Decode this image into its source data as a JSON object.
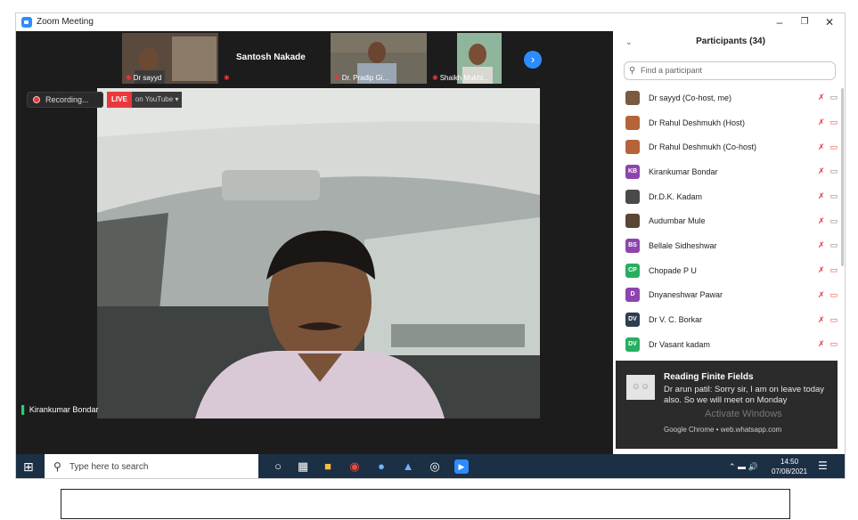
{
  "window": {
    "title": "Zoom Meeting"
  },
  "meeting": {
    "thumbnails": [
      {
        "name": "Dr sayyd"
      },
      {
        "name": "Santosh Nakade"
      },
      {
        "name": "Dr. Pradip Gi..."
      },
      {
        "name": "Shaikh Mukht..."
      }
    ],
    "recording_label": "Recording...",
    "live_label": "LIVE",
    "live_target": "on YouTube",
    "speaker_name": "Kirankumar Bondar"
  },
  "participants": {
    "header": "Participants (34)",
    "search_placeholder": "Find a participant",
    "list": [
      {
        "name": "Dr sayyd (Co-host, me)",
        "initials": "",
        "color": "#7a5a40"
      },
      {
        "name": "Dr Rahul Deshmukh (Host)",
        "initials": "",
        "color": "#b5643a"
      },
      {
        "name": "Dr Rahul Deshmukh (Co-host)",
        "initials": "",
        "color": "#b5643a"
      },
      {
        "name": "Kirankumar Bondar",
        "initials": "KB",
        "color": "#8e44ad"
      },
      {
        "name": "Dr.D.K. Kadam",
        "initials": "",
        "color": "#4a4a4a"
      },
      {
        "name": "Audumbar Mule",
        "initials": "",
        "color": "#5a4634"
      },
      {
        "name": "Bellale Sidheshwar",
        "initials": "BS",
        "color": "#8e44ad"
      },
      {
        "name": "Chopade P U",
        "initials": "CP",
        "color": "#27ae60"
      },
      {
        "name": "Dnyaneshwar Pawar",
        "initials": "D",
        "color": "#8e44ad"
      },
      {
        "name": "Dr V. C. Borkar",
        "initials": "DV",
        "color": "#2c3e50"
      },
      {
        "name": "Dr Vasant kadam",
        "initials": "DV",
        "color": "#27ae60"
      }
    ]
  },
  "notification": {
    "title": "Reading Finite Fields",
    "body": "Dr arun patil: Sorry sir, I am on leave today also. So we will meet on Monday",
    "source": "Google Chrome • web.whatsapp.com",
    "watermark": "Activate Windows"
  },
  "taskbar": {
    "search_placeholder": "Type here to search",
    "time": "14:50",
    "date": "07/08/2021"
  }
}
